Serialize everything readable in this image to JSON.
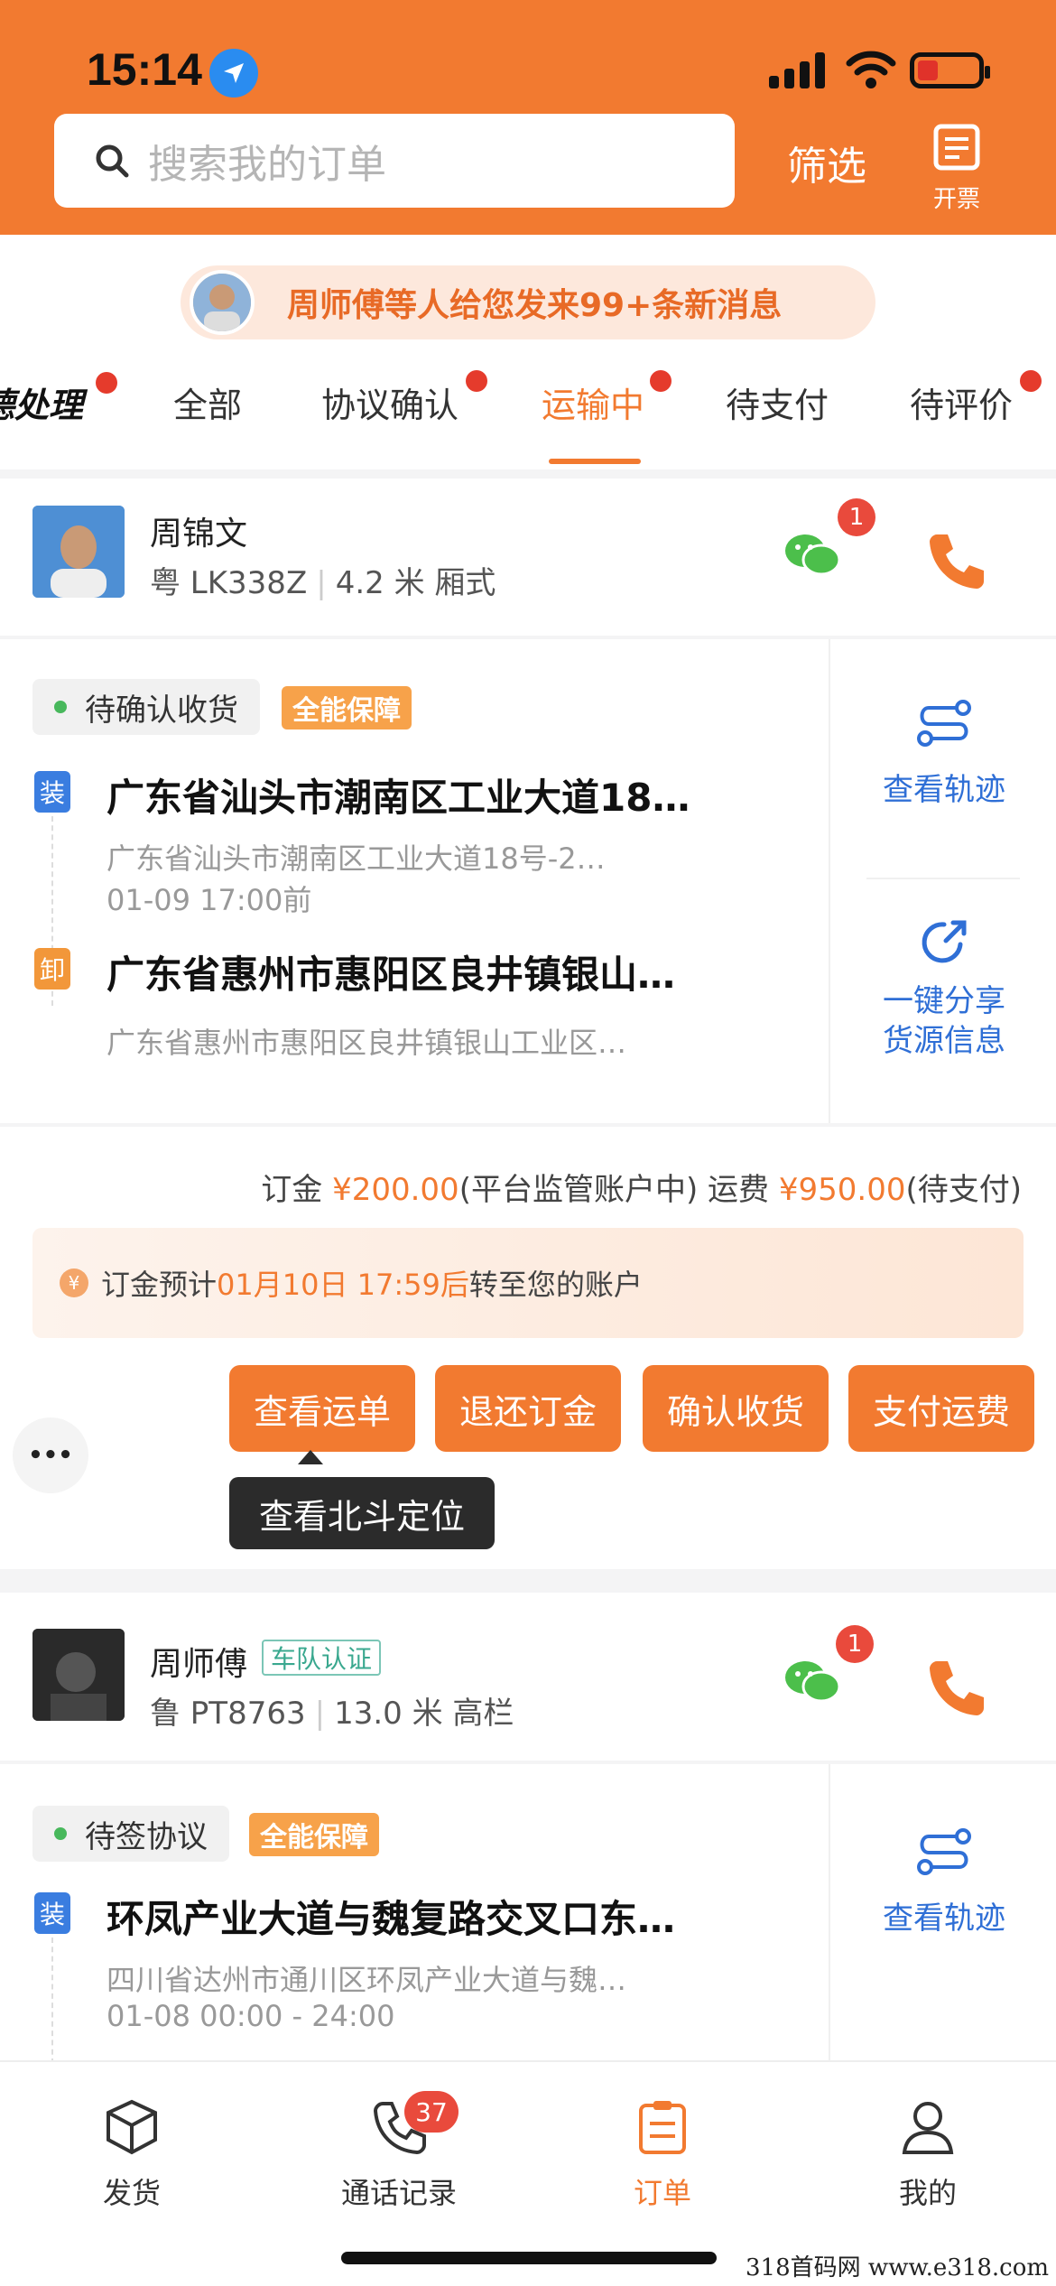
{
  "status_bar": {
    "time": "15:14"
  },
  "header": {
    "search_placeholder": "搜索我的订单",
    "filter_label": "筛选",
    "invoice_label": "开票"
  },
  "message_banner": {
    "text": "周师傅等人给您发来99+条新消息"
  },
  "tabs": [
    {
      "label": "待处理",
      "partial": "德处理"
    },
    {
      "label": "全部"
    },
    {
      "label": "协议确认"
    },
    {
      "label": "运输中"
    },
    {
      "label": "待支付"
    },
    {
      "label": "待评价"
    }
  ],
  "orders": [
    {
      "driver_name": "周锦文",
      "vehicle": "粤 LK338Z",
      "spec": "4.2 米 厢式",
      "chat_badge": "1",
      "status": "待确认收货",
      "guarantee": "全能保障",
      "load": {
        "tag": "装",
        "title": "广东省汕头市潮南区工业大道18…",
        "detail": "广东省汕头市潮南区工业大道18号-2…",
        "time": "01-09 17:00前"
      },
      "unload": {
        "tag": "卸",
        "title": "广东省惠州市惠阳区良井镇银山…",
        "detail": "广东省惠州市惠阳区良井镇银山工业区…"
      },
      "side_actions": [
        "查看轨迹",
        "一键分享货源信息"
      ],
      "share_line1": "一键分享",
      "share_line2": "货源信息",
      "deposit_label": "订金",
      "deposit_amount": "¥200.00",
      "deposit_note": "(平台监管账户中)",
      "freight_label": "运费",
      "freight_amount": "¥950.00",
      "freight_note": "(待支付)",
      "notice_pre": "订金预计",
      "notice_time": "01月10日 17:59后",
      "notice_post": "转至您的账户",
      "buttons": [
        "查看运单",
        "退还订金",
        "确认收货",
        "支付运费"
      ],
      "more": "•••",
      "tooltip": "查看北斗定位"
    },
    {
      "driver_name": "周师傅",
      "fleet_badge": "车队认证",
      "vehicle": "鲁 PT8763",
      "spec": "13.0 米 高栏",
      "chat_badge": "1",
      "status": "待签协议",
      "guarantee": "全能保障",
      "load": {
        "tag": "装",
        "title": "环凤产业大道与魏复路交叉口东…",
        "detail": "四川省达州市通川区环凤产业大道与魏…",
        "time": "01-08 00:00 - 24:00"
      },
      "side_actions": [
        "查看轨迹"
      ]
    }
  ],
  "bottom_nav": [
    {
      "label": "发货"
    },
    {
      "label": "通话记录",
      "badge": "37"
    },
    {
      "label": "订单"
    },
    {
      "label": "我的"
    }
  ],
  "watermark": "318首码网 www.e318.com"
}
